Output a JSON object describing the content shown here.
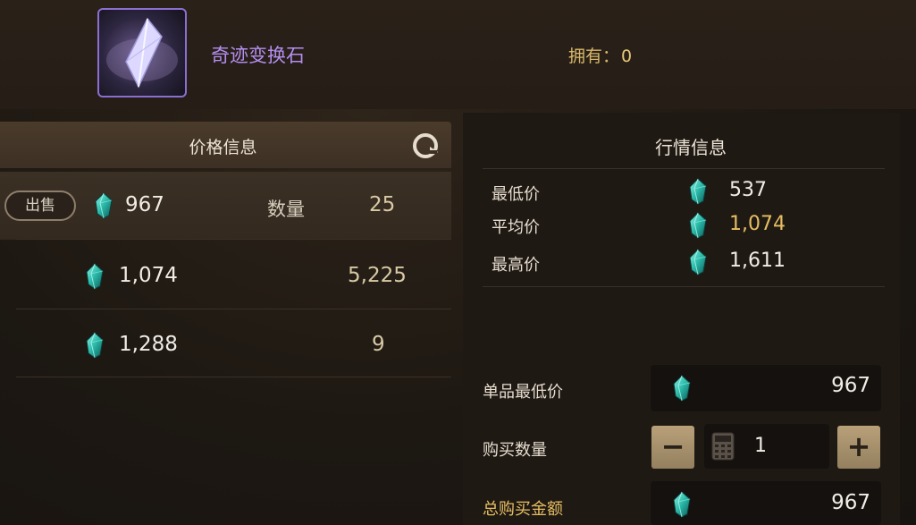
{
  "item": {
    "name": "奇迹变换石",
    "owned_label": "拥有：",
    "owned_count": "0",
    "icon": "purple-crystal-icon"
  },
  "price_panel": {
    "title": "价格信息",
    "refresh_icon": "refresh-icon",
    "sell_label": "出售",
    "qty_label": "数量",
    "rows": [
      {
        "price": "967",
        "qty": "25"
      },
      {
        "price": "1,074",
        "qty": "5,225"
      },
      {
        "price": "1,288",
        "qty": "9"
      }
    ]
  },
  "market_panel": {
    "title": "行情信息",
    "stats": [
      {
        "label": "最低价",
        "value": "537"
      },
      {
        "label": "平均价",
        "value": "1,074"
      },
      {
        "label": "最高价",
        "value": "1,611"
      }
    ]
  },
  "purchase": {
    "unit_min_label": "单品最低价",
    "unit_min_value": "967",
    "quantity_label": "购买数量",
    "quantity_value": "1",
    "minus_label": "−",
    "plus_label": "+",
    "total_label": "总购买金额",
    "total_value": "967"
  },
  "colors": {
    "gem": "#3ad1c0",
    "accent_gold": "#e6be62",
    "item_purple": "#b58ef0"
  }
}
